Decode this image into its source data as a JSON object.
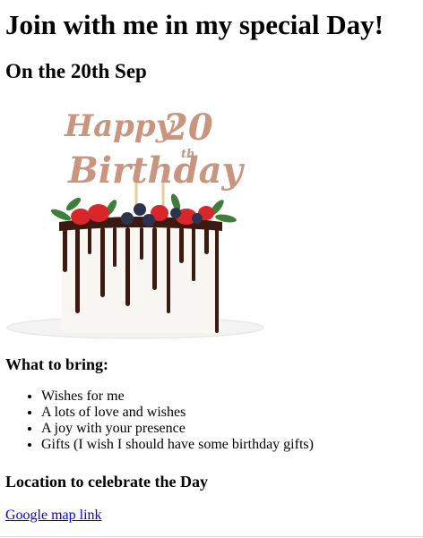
{
  "header": {
    "title": "Join with me in my special Day!",
    "subtitle": "On the 20th Sep"
  },
  "image": {
    "topper_line1": "Happy",
    "topper_number": "20",
    "topper_suffix": "th",
    "topper_line2": "Birthday"
  },
  "bring": {
    "heading": "What to bring:",
    "items": [
      "Wishes for me",
      "A lots of love and wishes",
      "A joy with your presence",
      "Gifts (I wish I should have some birthday gifts)"
    ]
  },
  "location": {
    "heading": "Location to celebrate the Day",
    "link_text": "Google map link"
  },
  "colors": {
    "link": "#0000ee",
    "topper": "#c9957e",
    "chocolate": "#3b1a12",
    "strawberry": "#d9262a",
    "blueberry": "#2c3350",
    "leaf": "#3f7d3a"
  }
}
